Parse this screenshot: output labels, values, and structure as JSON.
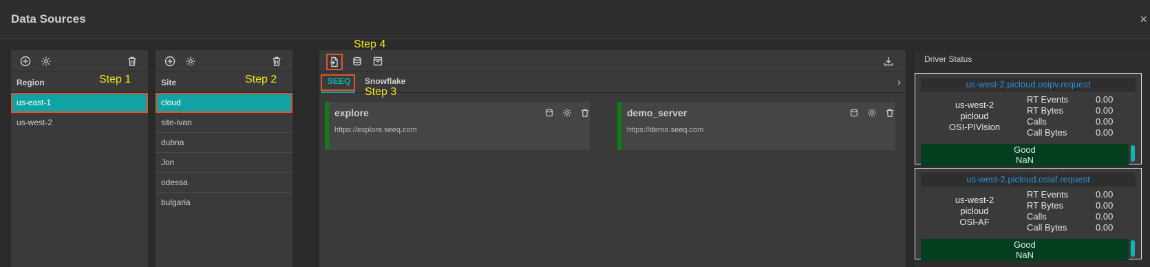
{
  "window": {
    "title": "Data Sources",
    "close_icon": "×"
  },
  "region_panel": {
    "header": "Region",
    "items": [
      {
        "label": "us-east-1",
        "selected": true
      },
      {
        "label": "us-west-2",
        "selected": false
      }
    ],
    "step": "Step 1"
  },
  "site_panel": {
    "header": "Site",
    "items": [
      {
        "label": "cloud",
        "selected": true
      },
      {
        "label": "site-ivan",
        "selected": false
      },
      {
        "label": "dubna",
        "selected": false
      },
      {
        "label": "Jon",
        "selected": false
      },
      {
        "label": "odessa",
        "selected": false
      },
      {
        "label": "bulgaria",
        "selected": false
      }
    ],
    "step": "Step 2"
  },
  "datasource_panel": {
    "step_toolbar": "Step 4",
    "step_tab": "Step 3",
    "tabs": [
      {
        "label": "SEEQ",
        "active": true
      },
      {
        "label": "Snowflake",
        "active": false
      }
    ],
    "cards": [
      {
        "name": "explore",
        "url": "https://explore.seeq.com"
      },
      {
        "name": "demo_server",
        "url": "https://demo.seeq.com"
      }
    ]
  },
  "driver_status": {
    "title": "Driver Status",
    "drivers": [
      {
        "name": "us-west-2.picloud.osipv.request",
        "info": [
          "us-west-2",
          "picloud",
          "OSI-PIVision"
        ],
        "metrics": [
          {
            "label": "RT Events",
            "value": "0.00"
          },
          {
            "label": "RT Bytes",
            "value": "0.00"
          },
          {
            "label": "Calls",
            "value": "0.00"
          },
          {
            "label": "Call Bytes",
            "value": "0.00"
          }
        ],
        "state": "Good",
        "state_value": "NaN"
      },
      {
        "name": "us-west-2.picloud.osiaf.request",
        "info": [
          "us-west-2",
          "picloud",
          "OSI-AF"
        ],
        "metrics": [
          {
            "label": "RT Events",
            "value": "0.00"
          },
          {
            "label": "RT Bytes",
            "value": "0.00"
          },
          {
            "label": "Calls",
            "value": "0.00"
          },
          {
            "label": "Call Bytes",
            "value": "0.00"
          }
        ],
        "state": "Good",
        "state_value": "NaN"
      }
    ]
  },
  "colors": {
    "accent": "#11a3a3",
    "highlight_border": "#e0552a",
    "step_text": "#f2e41a",
    "link": "#2b8fd6",
    "status_good_bg": "#053e1f",
    "card_bar": "#0d7d16"
  }
}
